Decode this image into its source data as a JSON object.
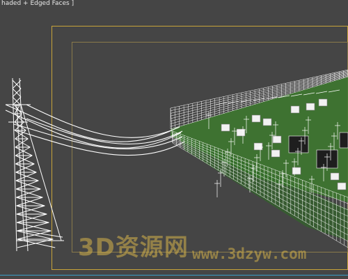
{
  "viewport": {
    "label": "haded + Edged Faces ]"
  },
  "watermark": {
    "brand": "3D资源网",
    "url": "www.3dzyw.com"
  },
  "colors": {
    "background": "#454545",
    "wireframe": "#ffffff",
    "ground": "#3d7a2e",
    "safe_frame": "#c8a43a",
    "watermark": "#d6b24a"
  }
}
